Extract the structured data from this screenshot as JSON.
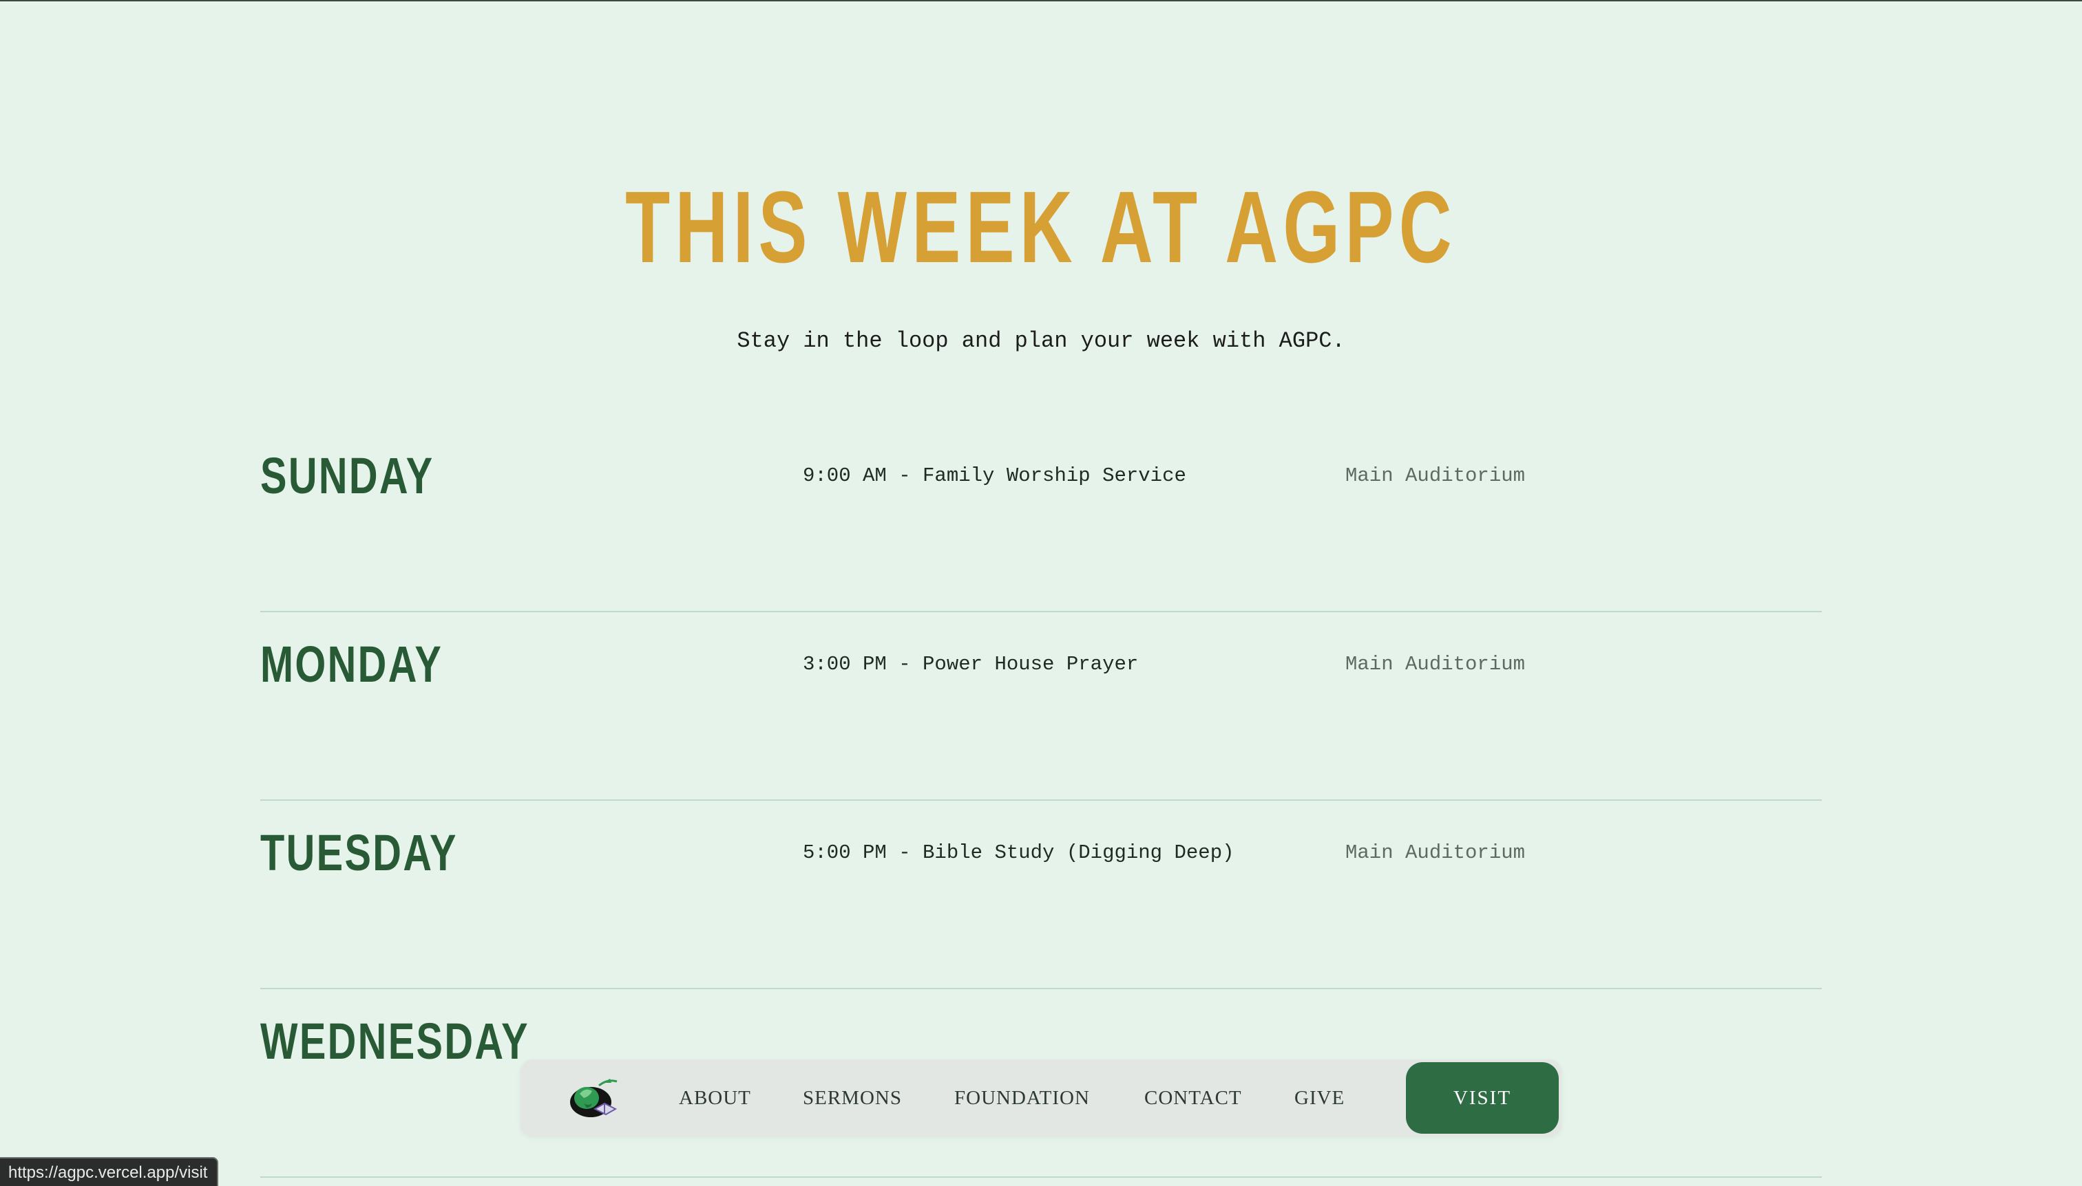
{
  "header": {
    "title": "THIS WEEK AT AGPC",
    "subtitle": "Stay in the loop and plan your week with AGPC."
  },
  "schedule": [
    {
      "day": "SUNDAY",
      "event": "9:00 AM - Family Worship Service",
      "location": "Main Auditorium"
    },
    {
      "day": "MONDAY",
      "event": "3:00 PM - Power House Prayer",
      "location": "Main Auditorium"
    },
    {
      "day": "TUESDAY",
      "event": "5:00 PM - Bible Study (Digging Deep)",
      "location": "Main Auditorium"
    },
    {
      "day": "WEDNESDAY",
      "event": "",
      "location": ""
    }
  ],
  "nav": {
    "logo_icon": "agpc-globe-logo-icon",
    "links": [
      "ABOUT",
      "SERMONS",
      "FOUNDATION",
      "CONTACT",
      "GIVE"
    ],
    "cta": "VISIT"
  },
  "status_bar": {
    "url": "https://agpc.vercel.app/visit"
  },
  "colors": {
    "background": "#e5f3ea",
    "title": "#d6a035",
    "day": "#285a36",
    "accent": "#2e6d44"
  }
}
